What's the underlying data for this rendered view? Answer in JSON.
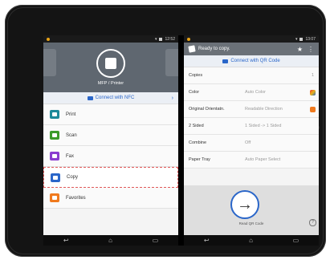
{
  "left": {
    "statusbar": {
      "time": "12:52"
    },
    "hero": {
      "label": "MFP / Printer"
    },
    "nfc": {
      "label": "Connect with NFC"
    },
    "menu": [
      {
        "label": "Print",
        "color": "#1e8a9a"
      },
      {
        "label": "Scan",
        "color": "#3c9a2a"
      },
      {
        "label": "Fax",
        "color": "#8a3ccf"
      },
      {
        "label": "Copy",
        "color": "#2a66c9"
      },
      {
        "label": "Favorites",
        "color": "#f07a1e"
      }
    ]
  },
  "right": {
    "statusbar": {
      "time": "13:07"
    },
    "header": {
      "title": "Ready to copy."
    },
    "qr": {
      "label": "Connect with QR Code"
    },
    "settings": [
      {
        "key": "Copies",
        "value": ""
      },
      {
        "key": "Color",
        "value": "Auto Color"
      },
      {
        "key": "Original Orientatn.",
        "value": "Readable Direction"
      },
      {
        "key": "2 Sided",
        "value": "1 Sided -> 1 Sided"
      },
      {
        "key": "Combine",
        "value": "Off"
      },
      {
        "key": "Paper Tray",
        "value": "Auto Paper Select"
      }
    ],
    "copies_value": "1",
    "read_qr_label": "Read QR Code",
    "help": "?"
  },
  "accent": "#2a66c9"
}
